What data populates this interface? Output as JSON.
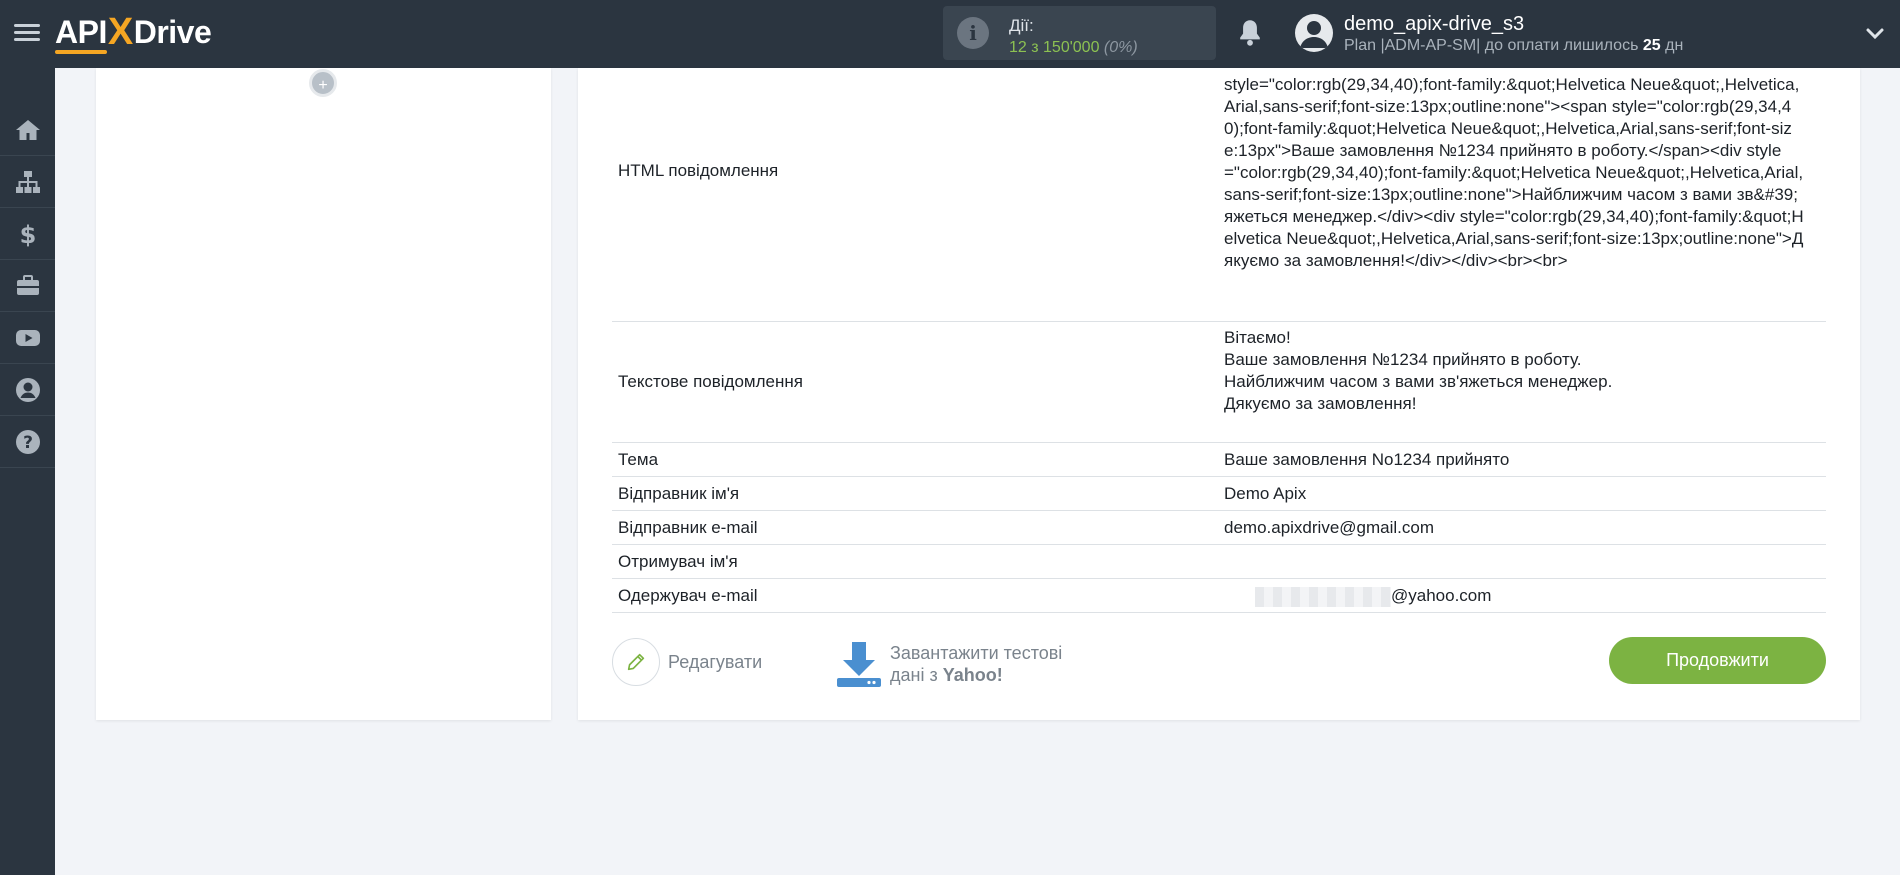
{
  "header": {
    "logo_api": "API",
    "logo_x": "X",
    "logo_drive": "Drive",
    "actions_label": "Дії:",
    "actions_value": "12 з 150'000",
    "actions_percent": "(0%)",
    "user_name": "demo_apix-drive_s3",
    "plan_prefix": "Plan |ADM-AP-SM| до оплати лишилось",
    "plan_days": "25",
    "plan_suffix": "дн"
  },
  "sidebar": {
    "items": [
      {
        "icon": "home-icon"
      },
      {
        "icon": "sitemap-icon"
      },
      {
        "icon": "dollar-icon"
      },
      {
        "icon": "briefcase-icon"
      },
      {
        "icon": "youtube-icon"
      },
      {
        "icon": "user-circle-icon"
      },
      {
        "icon": "help-icon"
      }
    ]
  },
  "fields": [
    {
      "key": "HTML повідомлення",
      "value": "style=\"color:rgb(29,34,40);font-family:&quot;Helvetica Neue&quot;,Helvetica,Arial,sans-serif;font-size:13px;outline:none\"><span style=\"color:rgb(29,34,40);font-family:&quot;Helvetica Neue&quot;,Helvetica,Arial,sans-serif;font-size:13px\">Ваше замовлення №1234 прийнято в роботу.</span><div style=\"color:rgb(29,34,40);font-family:&quot;Helvetica Neue&quot;,Helvetica,Arial,sans-serif;font-size:13px;outline:none\">Найближчим часом з вами зв&#39;яжеться менеджер.</div><div style=\"color:rgb(29,34,40);font-family:&quot;Helvetica Neue&quot;,Helvetica,Arial,sans-serif;font-size:13px;outline:none\">Дякуємо за замовлення!</div></div><br><br>"
    },
    {
      "key": "Текстове повідомлення",
      "value": "Вітаємо!\nВаше замовлення №1234 прийнято в роботу.\nНайближчим часом з вами зв'яжеться менеджер.\nДякуємо за замовлення!"
    },
    {
      "key": "Тема",
      "value": "Ваше замовлення No1234 прийнято"
    },
    {
      "key": "Відправник ім'я",
      "value": "Demo Apix"
    },
    {
      "key": "Відправник e-mail",
      "value": "demo.apixdrive@gmail.com"
    },
    {
      "key": "Отримувач ім'я",
      "value": ""
    },
    {
      "key": "Одержувач e-mail",
      "value": "@yahoo.com"
    }
  ],
  "buttons": {
    "edit_label": "Редагувати",
    "download_line1": "Завантажити тестові",
    "download_line2_prefix": "дані з",
    "download_line2_bold": "Yahoo!",
    "continue_label": "Продовжити",
    "add_label": "+"
  },
  "colors": {
    "topbar": "#2b3540",
    "accent_green": "#7cb342",
    "logo_orange": "#f5a623",
    "download_blue": "#4a8fd0"
  }
}
